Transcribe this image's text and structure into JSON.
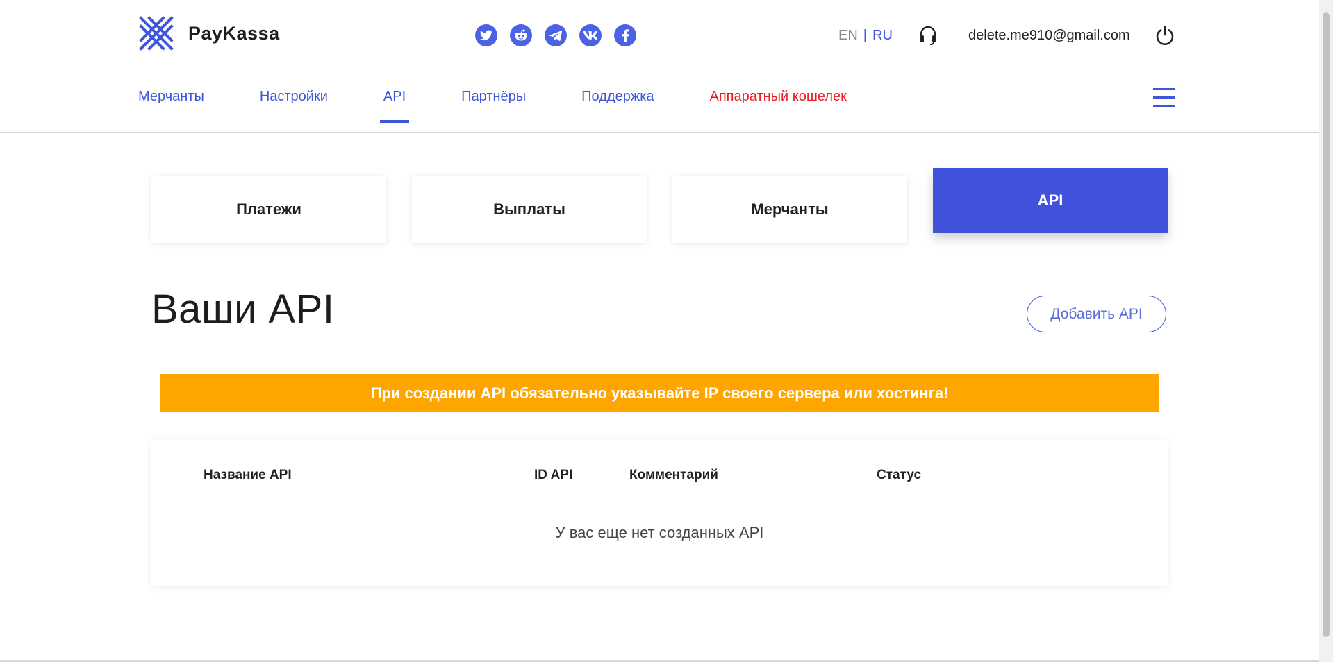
{
  "brand": {
    "name": "PayKassa"
  },
  "socials": [
    {
      "icon": "twitter-icon"
    },
    {
      "icon": "reddit-icon"
    },
    {
      "icon": "telegram-icon"
    },
    {
      "icon": "vk-icon"
    },
    {
      "icon": "facebook-icon"
    }
  ],
  "lang": {
    "en": "EN",
    "sep": "|",
    "ru": "RU",
    "active": "RU"
  },
  "user": {
    "email": "delete.me910@gmail.com"
  },
  "nav": {
    "items": [
      {
        "label": "Мерчанты"
      },
      {
        "label": "Настройки"
      },
      {
        "label": "API",
        "active": true
      },
      {
        "label": "Партнёры"
      },
      {
        "label": "Поддержка"
      },
      {
        "label": "Аппаратный кошелек",
        "color": "#ed1c24"
      }
    ]
  },
  "tabs": [
    {
      "label": "Платежи"
    },
    {
      "label": "Выплаты"
    },
    {
      "label": "Мерчанты"
    },
    {
      "label": "API",
      "active": true
    }
  ],
  "main": {
    "title": "Ваши API",
    "add_button": "Добавить API",
    "warning": "При создании API обязательно указывайте IP своего сервера или хостинга!",
    "table": {
      "headers": [
        "Название API",
        "ID API",
        "Комментарий",
        "Статус"
      ],
      "empty_text": "У вас еще нет созданных API"
    }
  },
  "colors": {
    "accent": "#4152dd",
    "warning": "#ffa500",
    "alert_text": "#ed1c24"
  }
}
